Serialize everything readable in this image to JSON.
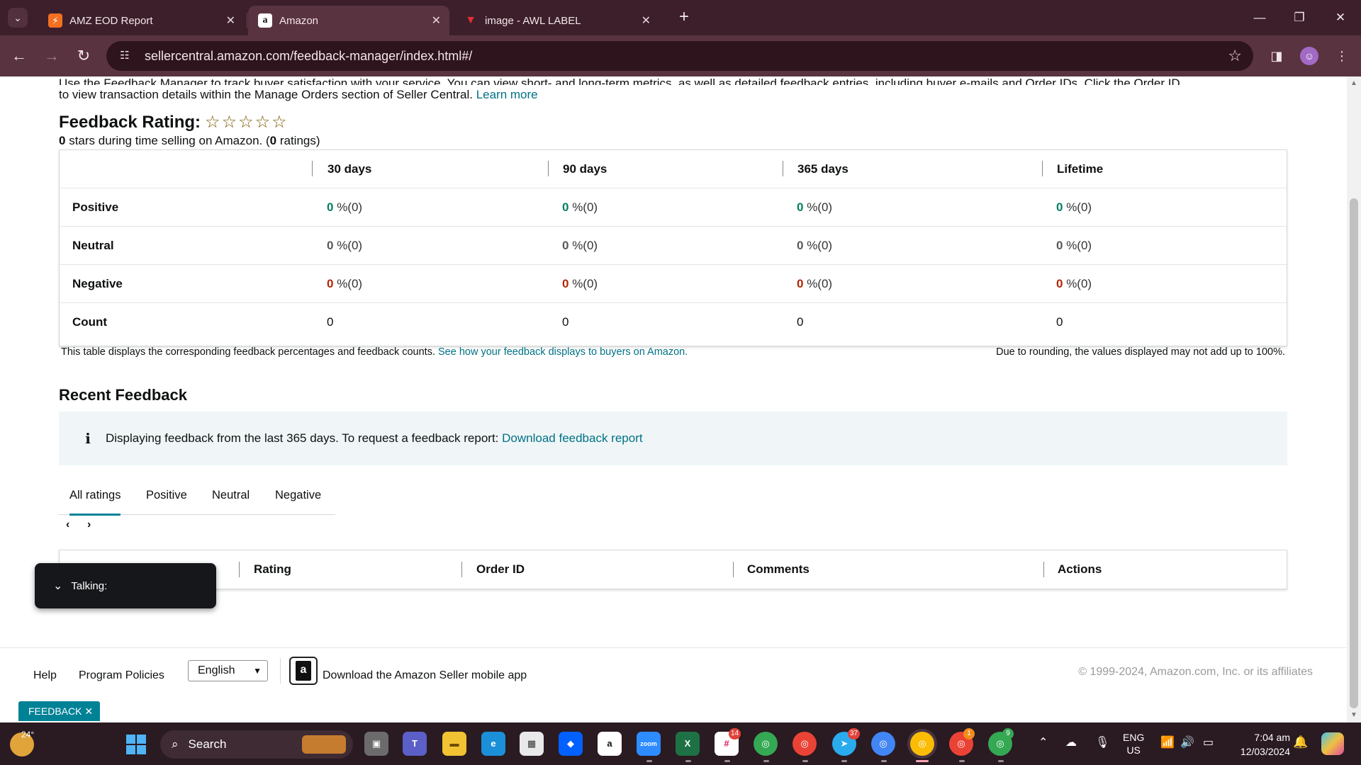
{
  "browser": {
    "tabs": [
      {
        "title": "AMZ EOD Report",
        "favicon": "zap-icon",
        "active": false
      },
      {
        "title": "Amazon",
        "favicon": "amazon-icon",
        "active": true
      },
      {
        "title": "image - AWL LABEL",
        "favicon": "label-icon",
        "active": false
      }
    ],
    "url": "sellercentral.amazon.com/feedback-manager/index.html#/"
  },
  "intro": {
    "cut_line": "Use the Feedback Manager to track buyer satisfaction with your service. You can view short- and long-term metrics, as well as detailed feedback entries, including buyer e-mails and Order IDs. Click the Order ID",
    "line2": "to view transaction details within the Manage Orders section of Seller Central.",
    "learn_more": "Learn more"
  },
  "rating": {
    "title": "Feedback Rating:",
    "stars": 0,
    "stars_max": 5,
    "summary_value": "0",
    "summary_text": " stars during time selling on Amazon. (",
    "ratings_count": "0",
    "ratings_suffix": " ratings)"
  },
  "metrics": {
    "columns": [
      "30 days",
      "90 days",
      "365 days",
      "Lifetime"
    ],
    "rows": [
      {
        "label": "Positive",
        "values": [
          "0",
          "0",
          "0",
          "0"
        ],
        "suffix": " %(0)",
        "color": "#067d62"
      },
      {
        "label": "Neutral",
        "values": [
          "0",
          "0",
          "0",
          "0"
        ],
        "suffix": " %(0)",
        "color": "#565959"
      },
      {
        "label": "Negative",
        "values": [
          "0",
          "0",
          "0",
          "0"
        ],
        "suffix": " %(0)",
        "color": "#b12704"
      },
      {
        "label": "Count",
        "values": [
          "0",
          "0",
          "0",
          "0"
        ],
        "suffix": ""
      }
    ],
    "note_left": "This table displays the corresponding feedback percentages and feedback counts.",
    "note_left_link": "See how your feedback displays to buyers on Amazon.",
    "note_right": "Due to rounding, the values displayed may not add up to 100%."
  },
  "recent": {
    "title": "Recent Feedback",
    "info_text": "Displaying feedback from the last 365 days. To request a feedback report:",
    "info_link": "Download feedback report",
    "tabs": [
      "All ratings",
      "Positive",
      "Neutral",
      "Negative"
    ],
    "active_tab": "All ratings",
    "columns": [
      "Rating",
      "Order ID",
      "Comments",
      "Actions"
    ]
  },
  "overlay": {
    "talking_label": "Talking:"
  },
  "footer": {
    "help": "Help",
    "policies": "Program Policies",
    "language": "English",
    "app_text": "Download the Amazon Seller mobile app",
    "copyright": "© 1999-2024, Amazon.com, Inc. or its affiliates",
    "feedback_btn": "FEEDBACK"
  },
  "taskbar": {
    "weather_temp": "24°",
    "search_placeholder": "Search",
    "lang_line1": "ENG",
    "lang_line2": "US",
    "time": "7:04 am",
    "date": "12/03/2024",
    "badges": {
      "slack": "14",
      "telegram": "37",
      "chrome_orange": "1",
      "chrome_green": "9"
    }
  },
  "colors": {
    "accent_teal": "#008296",
    "link": "#007185",
    "positive": "#067d62",
    "negative": "#b12704",
    "tabbar": "#3c1f2a"
  }
}
